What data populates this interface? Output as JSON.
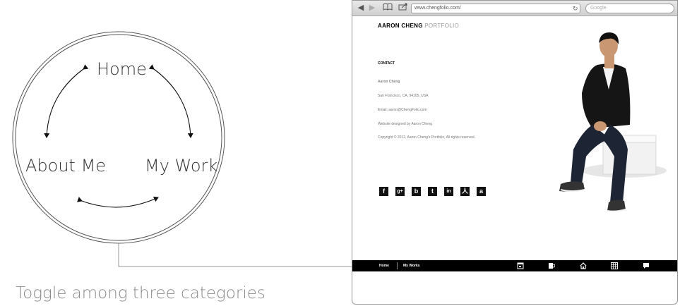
{
  "diagram": {
    "nodes": {
      "home": "Home",
      "about": "About Me",
      "work": "My Work"
    },
    "caption": "Toggle among three categories"
  },
  "browser": {
    "toolbar": {
      "back_icon": "back-arrow-icon",
      "forward_icon": "forward-arrow-icon",
      "bookmarks_icon": "book-icon",
      "share_icon": "share-icon",
      "url": "www.chengfolio.com/",
      "reload_icon": "reload-icon",
      "search_placeholder": "Google"
    },
    "brand": {
      "name": "AARON CHENG",
      "suffix": " PORTFOLIO"
    },
    "contact": {
      "heading": "CONTACT",
      "name": "Aaron Cheng",
      "location": "San Francisco, CA, 94105, USA",
      "email": "Email: aaron@ChengFolio.com",
      "designer": "Website designed by Aaron Cheng",
      "copyright": "Copyright © 2012, Aaron Cheng's Portfolio, All rights reserved."
    },
    "social": [
      {
        "name": "facebook-icon",
        "glyph": "f"
      },
      {
        "name": "google-plus-icon",
        "glyph": "g+"
      },
      {
        "name": "blogger-icon",
        "glyph": "b"
      },
      {
        "name": "tumblr-icon",
        "glyph": "t"
      },
      {
        "name": "linkedin-icon",
        "glyph": "in"
      },
      {
        "name": "renren-icon",
        "glyph": "人"
      },
      {
        "name": "douban-icon",
        "glyph": "a"
      }
    ],
    "footer": {
      "home_label": "Home",
      "works_label": "My Works",
      "icons": [
        "window-icon",
        "mug-icon",
        "home-icon",
        "grid-icon",
        "chat-icon"
      ]
    }
  }
}
